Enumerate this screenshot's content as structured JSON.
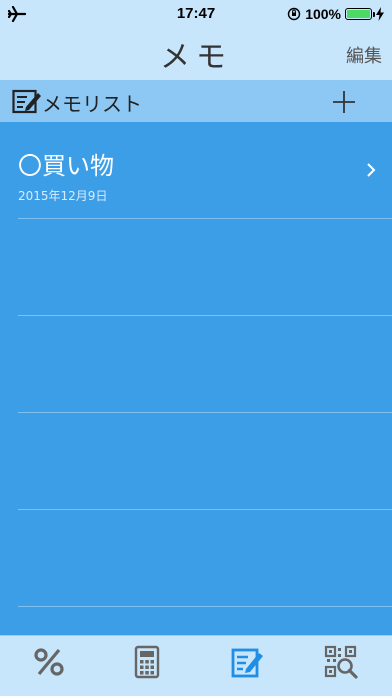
{
  "status_bar": {
    "time": "17:47",
    "battery": "100%",
    "icons": [
      "airplane-icon",
      "orientation-lock-icon",
      "battery-icon",
      "charging-icon"
    ]
  },
  "nav": {
    "title": "メモ",
    "edit_label": "編集"
  },
  "subheader": {
    "icon": "memo-icon",
    "label": "メモリスト",
    "add_icon": "plus-icon"
  },
  "memos": [
    {
      "title": "〇買い物",
      "date": "2015年12月9日"
    },
    {
      "title": "",
      "date": ""
    },
    {
      "title": "",
      "date": ""
    },
    {
      "title": "",
      "date": ""
    },
    {
      "title": "",
      "date": ""
    }
  ],
  "tabs": [
    {
      "name": "percent",
      "icon": "percent-icon",
      "active": false
    },
    {
      "name": "calculator",
      "icon": "calculator-icon",
      "active": false
    },
    {
      "name": "memo",
      "icon": "memo-icon",
      "active": true
    },
    {
      "name": "qr",
      "icon": "qr-search-icon",
      "active": false
    }
  ],
  "colors": {
    "bar_bg": "#c8e6fb",
    "subheader_bg": "#8cc8f3",
    "list_bg": "#3d9ee8",
    "active_tab": "#1f8ee6",
    "inactive_tab": "#666666"
  }
}
